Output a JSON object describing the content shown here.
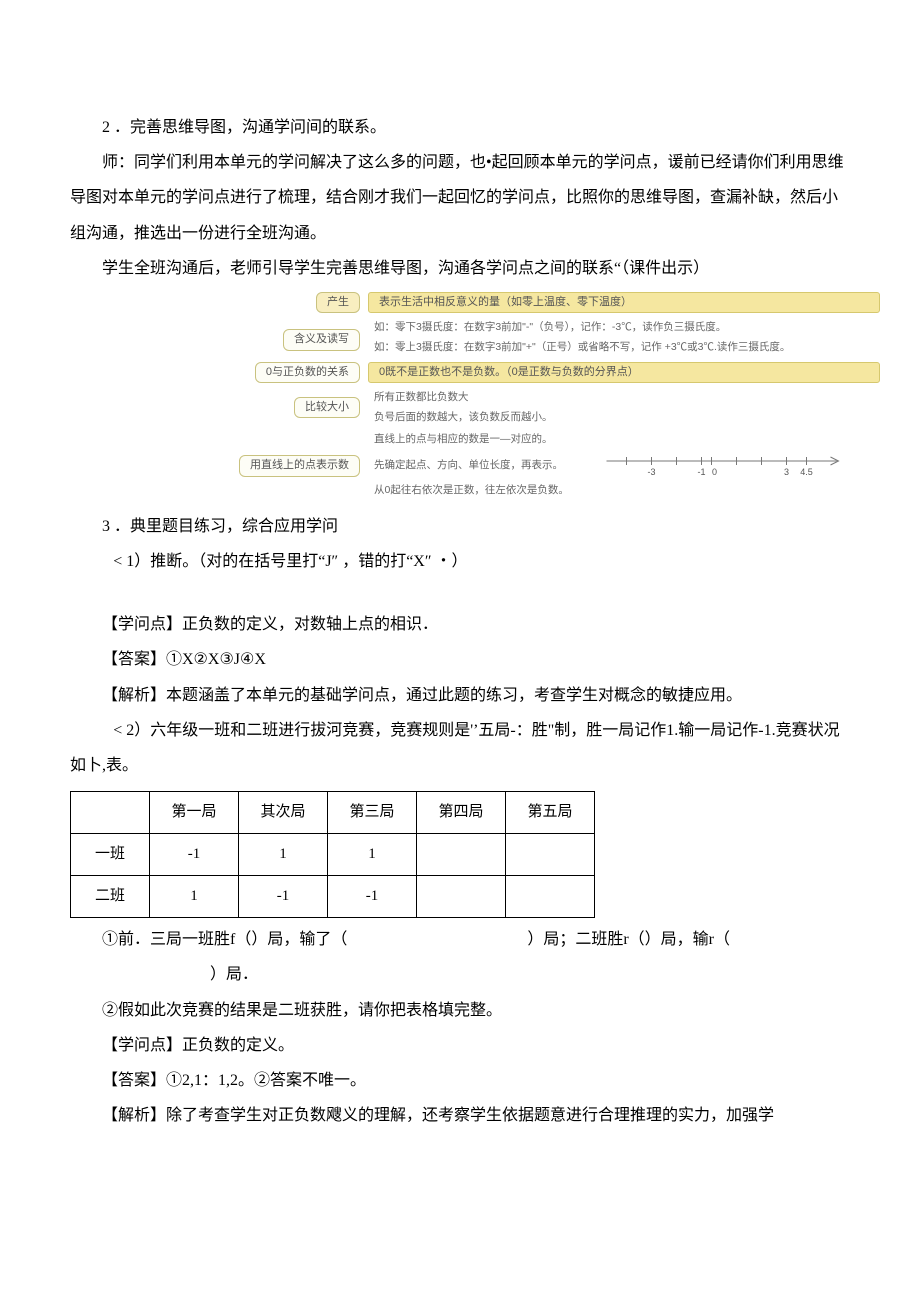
{
  "paragraphs": {
    "p1": "2 ．完善思维导图，沟通学问间的联系。",
    "p2": "师：同学们利用本单元的学问解决了这么多的问题，也•起回顾本单元的学问点，谖前已经请你们利用思维导图对本单元的学问点进行了梳理，结合刚才我们一起回忆的学问点，比照你的思维导图，查漏补缺，然后小组沟通，推选出一份进行全班沟通。",
    "p3": "学生全班沟通后，老师引导学生完善思维导图，沟通各学问点之间的联系“（课件出示）",
    "p4": "3 ．典里题目练习，综合应用学问",
    "p5": "< 1）推断。（对的在括号里打“J″ ，错的打“X″ ・）",
    "p6": "【学问点】正负数的定义，对数轴上点的相识．",
    "p7": "【答案】①X②X③J④X",
    "p8": "【解析】本题涵盖了本单元的基础学问点，通过此题的练习，考查学生对概念的敏捷应用。",
    "p9": "< 2）六年级一班和二班进行拔河竞赛，竞赛规则是'’五局-：胜\"制，胜一局记作1.输一局记作-1.竞赛状况如卜,表。",
    "p10a": "①前．三局一班胜f（）局，输了（",
    "p10b": "）局；二班胜r（）局，输r（",
    "p10c": "）局．",
    "p11": "②假如此次竞赛的结果是二班获胜，请你把表格填完整。",
    "p12": "【学问点】正负数的定义。",
    "p13": "【答案】①2,1：1,2。②答案不唯一。",
    "p14": "【解析】除了考查学生对正负数飕义的理解，还考察学生依据题意进行合理推理的实力，加强学"
  },
  "mindmap": {
    "r1": {
      "left": "产生",
      "right": "表示生活中相反意义的量（如零上温度、零下温度）"
    },
    "r2": {
      "left": "含义及读写",
      "line1": "如：零下3摄氏度：在数字3前加\"-\"（负号），记作：-3℃，读作负三摄氏度。",
      "line2": "如：零上3摄氏度：在数字3前加\"+\"（正号）或省略不写，记作 +3℃或3℃.读作三摄氏度。"
    },
    "r3": {
      "left": "0与正负数的关系",
      "right": "0既不是正数也不是负数。（0是正数与负数的分界点）"
    },
    "r4": {
      "left": "比较大小",
      "line1": "所有正数都比负数大",
      "line2": "负号后面的数越大，该负数反而越小。"
    },
    "r5": {
      "left": "用直线上的点表示数",
      "top": "直线上的点与相应的数是一—对应的。",
      "mid": "先确定起点、方向、单位长度，再表示。",
      "bottom": "从0起往右依次是正数，往左依次是负数。"
    },
    "ticks": {
      "n3": "-3",
      "n1": "-1",
      "z": "0",
      "p3": "3",
      "p45": "4.5"
    }
  },
  "table": {
    "headers": [
      "",
      "第一局",
      "其次局",
      "第三局",
      "第四局",
      "第五局"
    ],
    "rows": [
      {
        "label": "一班",
        "cells": [
          "-1",
          "1",
          "1",
          "",
          ""
        ]
      },
      {
        "label": "二班",
        "cells": [
          "1",
          "-1",
          "-1",
          "",
          ""
        ]
      }
    ]
  }
}
